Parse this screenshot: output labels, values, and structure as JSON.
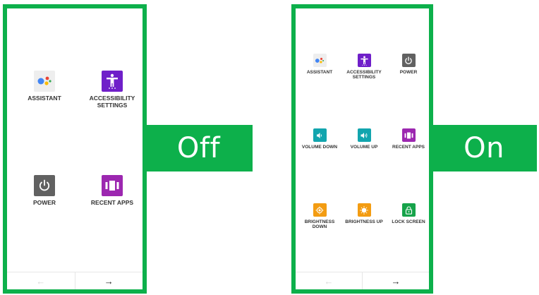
{
  "colors": {
    "frame": "#0db04b",
    "assistant_bg": "#eeeeee",
    "accessibility_bg": "#6f1fc9",
    "power_bg": "#616161",
    "recent_apps_bg": "#9c27b0",
    "volume_bg": "#12a5ae",
    "brightness_bg": "#f39c12",
    "lock_bg": "#16a34a"
  },
  "off_state": {
    "label": "Off",
    "tiles": {
      "assistant": {
        "label": "ASSISTANT",
        "icon": "google-assistant-icon"
      },
      "accessibility": {
        "label": "ACCESSIBILITY\nSETTINGS",
        "icon": "accessibility-person-icon"
      },
      "power": {
        "label": "POWER",
        "icon": "power-icon"
      },
      "recent_apps": {
        "label": "RECENT APPS",
        "icon": "recent-apps-icon"
      }
    },
    "nav": {
      "back": "←",
      "next": "→"
    }
  },
  "on_state": {
    "label": "On",
    "tiles": {
      "assistant": {
        "label": "ASSISTANT",
        "icon": "google-assistant-icon"
      },
      "accessibility": {
        "label": "ACCESSIBILITY\nSETTINGS",
        "icon": "accessibility-person-icon"
      },
      "power": {
        "label": "POWER",
        "icon": "power-icon"
      },
      "volume_down": {
        "label": "VOLUME DOWN",
        "icon": "volume-down-icon"
      },
      "volume_up": {
        "label": "VOLUME UP",
        "icon": "volume-up-icon"
      },
      "recent_apps": {
        "label": "RECENT APPS",
        "icon": "recent-apps-icon"
      },
      "brightness_down": {
        "label": "BRIGHTNESS\nDOWN",
        "icon": "brightness-down-icon"
      },
      "brightness_up": {
        "label": "BRIGHTNESS UP",
        "icon": "brightness-up-icon"
      },
      "lock_screen": {
        "label": "LOCK SCREEN",
        "icon": "lock-icon"
      }
    },
    "nav": {
      "back": "←",
      "next": "→"
    }
  }
}
